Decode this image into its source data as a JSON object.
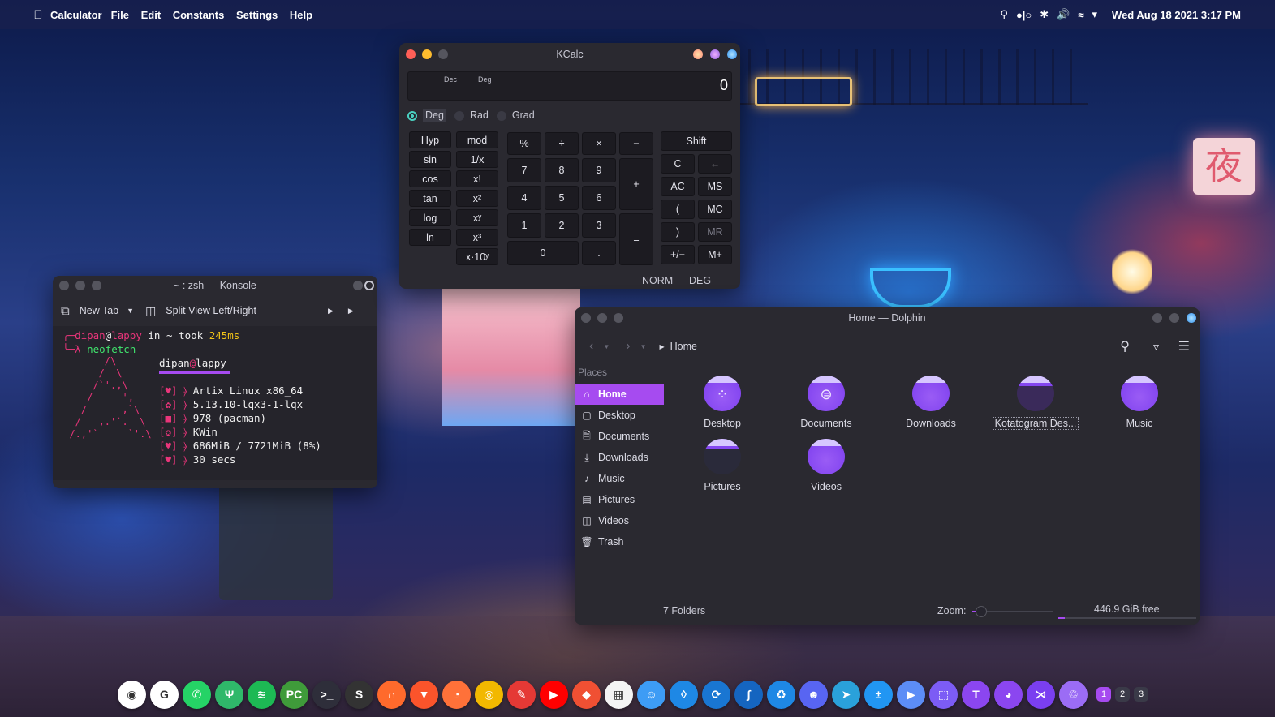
{
  "topbar": {
    "app_name": "Calculator",
    "menu": [
      "File",
      "Edit",
      "Constants",
      "Settings",
      "Help"
    ],
    "datetime": "Wed Aug 18 2021  3:17 PM"
  },
  "kcalc": {
    "title": "KCalc",
    "display_value": "0",
    "indicator_base": "Dec",
    "indicator_angle": "Deg",
    "angle_modes": [
      "Deg",
      "Rad",
      "Grad"
    ],
    "selected_angle": "Deg",
    "func_col1": [
      "Hyp",
      "sin",
      "cos",
      "tan",
      "log",
      "ln"
    ],
    "func_col2": [
      "mod",
      "1/x",
      "x!",
      "x²",
      "xʸ",
      "x³",
      "x·10ʸ"
    ],
    "ops_row": [
      "%",
      "÷",
      "×",
      "−"
    ],
    "digits_row1": [
      "7",
      "8",
      "9"
    ],
    "digits_row2": [
      "4",
      "5",
      "6"
    ],
    "digits_row3": [
      "1",
      "2",
      "3"
    ],
    "zero": "0",
    "dot": ".",
    "plus": "+",
    "equals": "=",
    "memory_col1": [
      "Shift",
      "C",
      "AC",
      "(",
      ")",
      "+/−"
    ],
    "memory_col2": [
      "←",
      "MS",
      "MC",
      "MR",
      "M+"
    ],
    "status_mode": "NORM",
    "status_angle": "DEG"
  },
  "konsole": {
    "title": "~ : zsh — Konsole",
    "new_tab": "New Tab",
    "split_view": "Split View Left/Right",
    "prompt_user": "dipan",
    "prompt_host": "lappy",
    "prompt_in": "in",
    "prompt_dir": "~",
    "prompt_took": "took",
    "prompt_time": "245ms",
    "command": "neofetch",
    "nf_title_user": "dipan",
    "nf_title_host": "lappy",
    "nf_lines": [
      "Artix Linux x86_64",
      "5.13.10-lqx3-1-lqx",
      "978 (pacman)",
      "KWin",
      "686MiB / 7721MiB (8%)",
      "30 secs"
    ],
    "ascii_art": [
      "        /\\",
      "       /  \\",
      "      /`'.,\\",
      "     /     ',",
      "    /      ,`\\",
      "   /   ,.'`.  \\",
      "  /.,'`     `'.\\"
    ]
  },
  "dolphin": {
    "title": "Home — Dolphin",
    "breadcrumb": "Home",
    "places_header": "Places",
    "places": [
      "Home",
      "Desktop",
      "Documents",
      "Downloads",
      "Music",
      "Pictures",
      "Videos",
      "Trash"
    ],
    "folders": [
      "Desktop",
      "Documents",
      "Downloads",
      "Kotatogram Des...",
      "Music",
      "Pictures",
      "Videos"
    ],
    "status_count": "7 Folders",
    "zoom_label": "Zoom:",
    "free_space": "446.9 GiB free"
  },
  "dock": {
    "workspaces": [
      "1",
      "2",
      "3"
    ],
    "apps": [
      {
        "icon": "toggle-icon",
        "color": "#ffffff"
      },
      {
        "icon": "google-icon",
        "color": "#ffffff"
      },
      {
        "icon": "whatsapp-icon",
        "color": "#25d366"
      },
      {
        "icon": "tuning-fork-icon",
        "color": "#2fb86a"
      },
      {
        "icon": "spotify-icon",
        "color": "#1db954"
      },
      {
        "icon": "pycharm-icon",
        "color": "#3f9b3a"
      },
      {
        "icon": "terminal-icon",
        "color": "#2e2e3a"
      },
      {
        "icon": "sublime-icon",
        "color": "#333333"
      },
      {
        "icon": "headphones-icon",
        "color": "#ff6a2c"
      },
      {
        "icon": "brave-icon",
        "color": "#fb542b"
      },
      {
        "icon": "firefox-icon",
        "color": "#ff7139"
      },
      {
        "icon": "chrome-icon",
        "color": "#f2b800"
      },
      {
        "icon": "feather-icon",
        "color": "#e53935"
      },
      {
        "icon": "youtube-icon",
        "color": "#ff0000"
      },
      {
        "icon": "git-icon",
        "color": "#f05033"
      },
      {
        "icon": "calendar-icon",
        "color": "#f4f4f4"
      },
      {
        "icon": "finder-icon",
        "color": "#3d9cf5"
      },
      {
        "icon": "drop-icon",
        "color": "#1e88e5"
      },
      {
        "icon": "sync-icon",
        "color": "#1976d2"
      },
      {
        "icon": "feather-blue-icon",
        "color": "#1565c0"
      },
      {
        "icon": "recycle-icon",
        "color": "#1e88e5"
      },
      {
        "icon": "discord-icon",
        "color": "#5865f2"
      },
      {
        "icon": "telegram-icon",
        "color": "#2aa1da"
      },
      {
        "icon": "calculator-icon",
        "color": "#2196f3"
      },
      {
        "icon": "play-icon",
        "color": "#5c8df6"
      },
      {
        "icon": "screenshot-icon",
        "color": "#7c5cf5"
      },
      {
        "icon": "typora-icon",
        "color": "#8b46f0"
      },
      {
        "icon": "github-icon",
        "color": "#8b46f0"
      },
      {
        "icon": "vscode-icon",
        "color": "#7a3ff0"
      },
      {
        "icon": "trash-icon",
        "color": "#9b6cf5"
      }
    ]
  },
  "colors": {
    "accent": "#a64bf0",
    "close": "#ff5f57",
    "minimize": "#febc2e",
    "terminal_pink": "#e9357a",
    "terminal_green": "#40e36d",
    "terminal_yellow": "#f2c418"
  }
}
